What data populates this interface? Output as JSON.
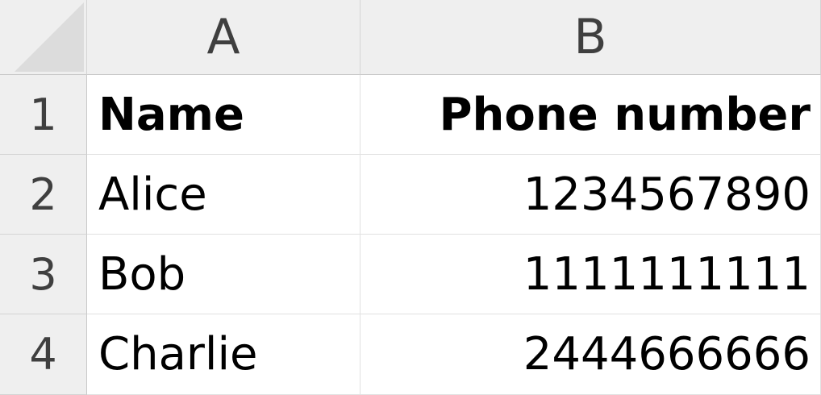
{
  "columns": [
    {
      "id": "A",
      "label": "A"
    },
    {
      "id": "B",
      "label": "B"
    }
  ],
  "rows": [
    {
      "label": "1",
      "name": "Name",
      "phone": "Phone number"
    },
    {
      "label": "2",
      "name": "Alice",
      "phone": "1234567890"
    },
    {
      "label": "3",
      "name": "Bob",
      "phone": "1111111111"
    },
    {
      "label": "4",
      "name": "Charlie",
      "phone": "2444666666"
    }
  ]
}
